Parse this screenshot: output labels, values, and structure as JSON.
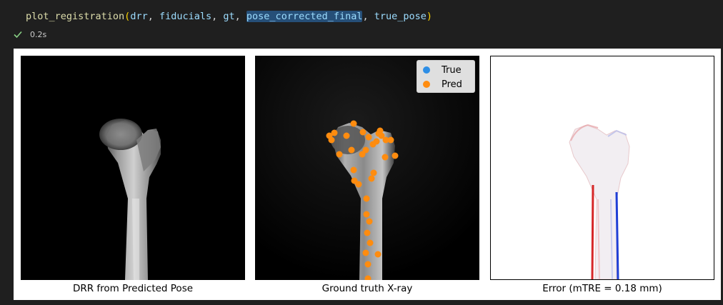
{
  "code": {
    "fn": "plot_registration",
    "args": [
      "drr",
      "fiducials",
      "gt",
      "pose_corrected_final",
      "true_pose"
    ],
    "highlighted_arg": "pose_corrected_final"
  },
  "status": {
    "duration": "0.2s"
  },
  "panels": [
    {
      "caption": "DRR from Predicted Pose"
    },
    {
      "caption": "Ground truth X-ray"
    },
    {
      "caption": "Error (mTRE = 0.18 mm)"
    }
  ],
  "legend": {
    "items": [
      {
        "label": "True",
        "color": "#1f77b4"
      },
      {
        "label": "Pred",
        "color": "#ff7f0e"
      }
    ]
  },
  "colors": {
    "true_marker": "#2d8ee6",
    "pred_marker": "#ff8c0f",
    "error_positive": "#d62728",
    "error_negative": "#1f3fd6"
  }
}
